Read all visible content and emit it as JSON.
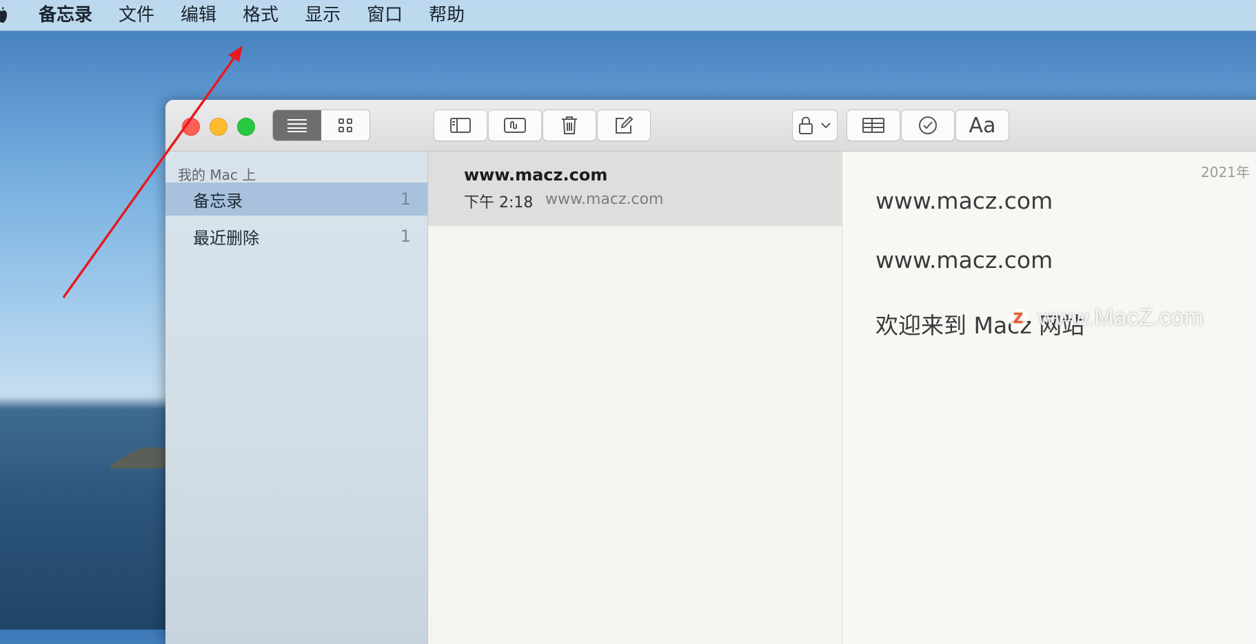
{
  "menubar": {
    "app_name": "备忘录",
    "items": [
      "文件",
      "编辑",
      "格式",
      "显示",
      "窗口",
      "帮助"
    ]
  },
  "toolbar": {
    "aa_label": "Aa"
  },
  "sidebar": {
    "section": "我的 Mac 上",
    "items": [
      {
        "label": "备忘录",
        "count": "1"
      },
      {
        "label": "最近删除",
        "count": "1"
      }
    ]
  },
  "notelist": {
    "notes": [
      {
        "title": "www.macz.com",
        "time": "下午 2:18",
        "snippet": "www.macz.com"
      }
    ]
  },
  "editor": {
    "date": "2021年",
    "lines": [
      "www.macz.com",
      "www.macz.com",
      "欢迎来到 Macz 网站"
    ]
  },
  "watermark": {
    "text": "www.MacZ.com",
    "logo_letter": "Z"
  },
  "colors": {
    "arrow": "#e8191f",
    "selection": "#a8c2dd",
    "close": "#fe5f57",
    "minimize": "#febc2e",
    "maximize": "#28c840"
  }
}
